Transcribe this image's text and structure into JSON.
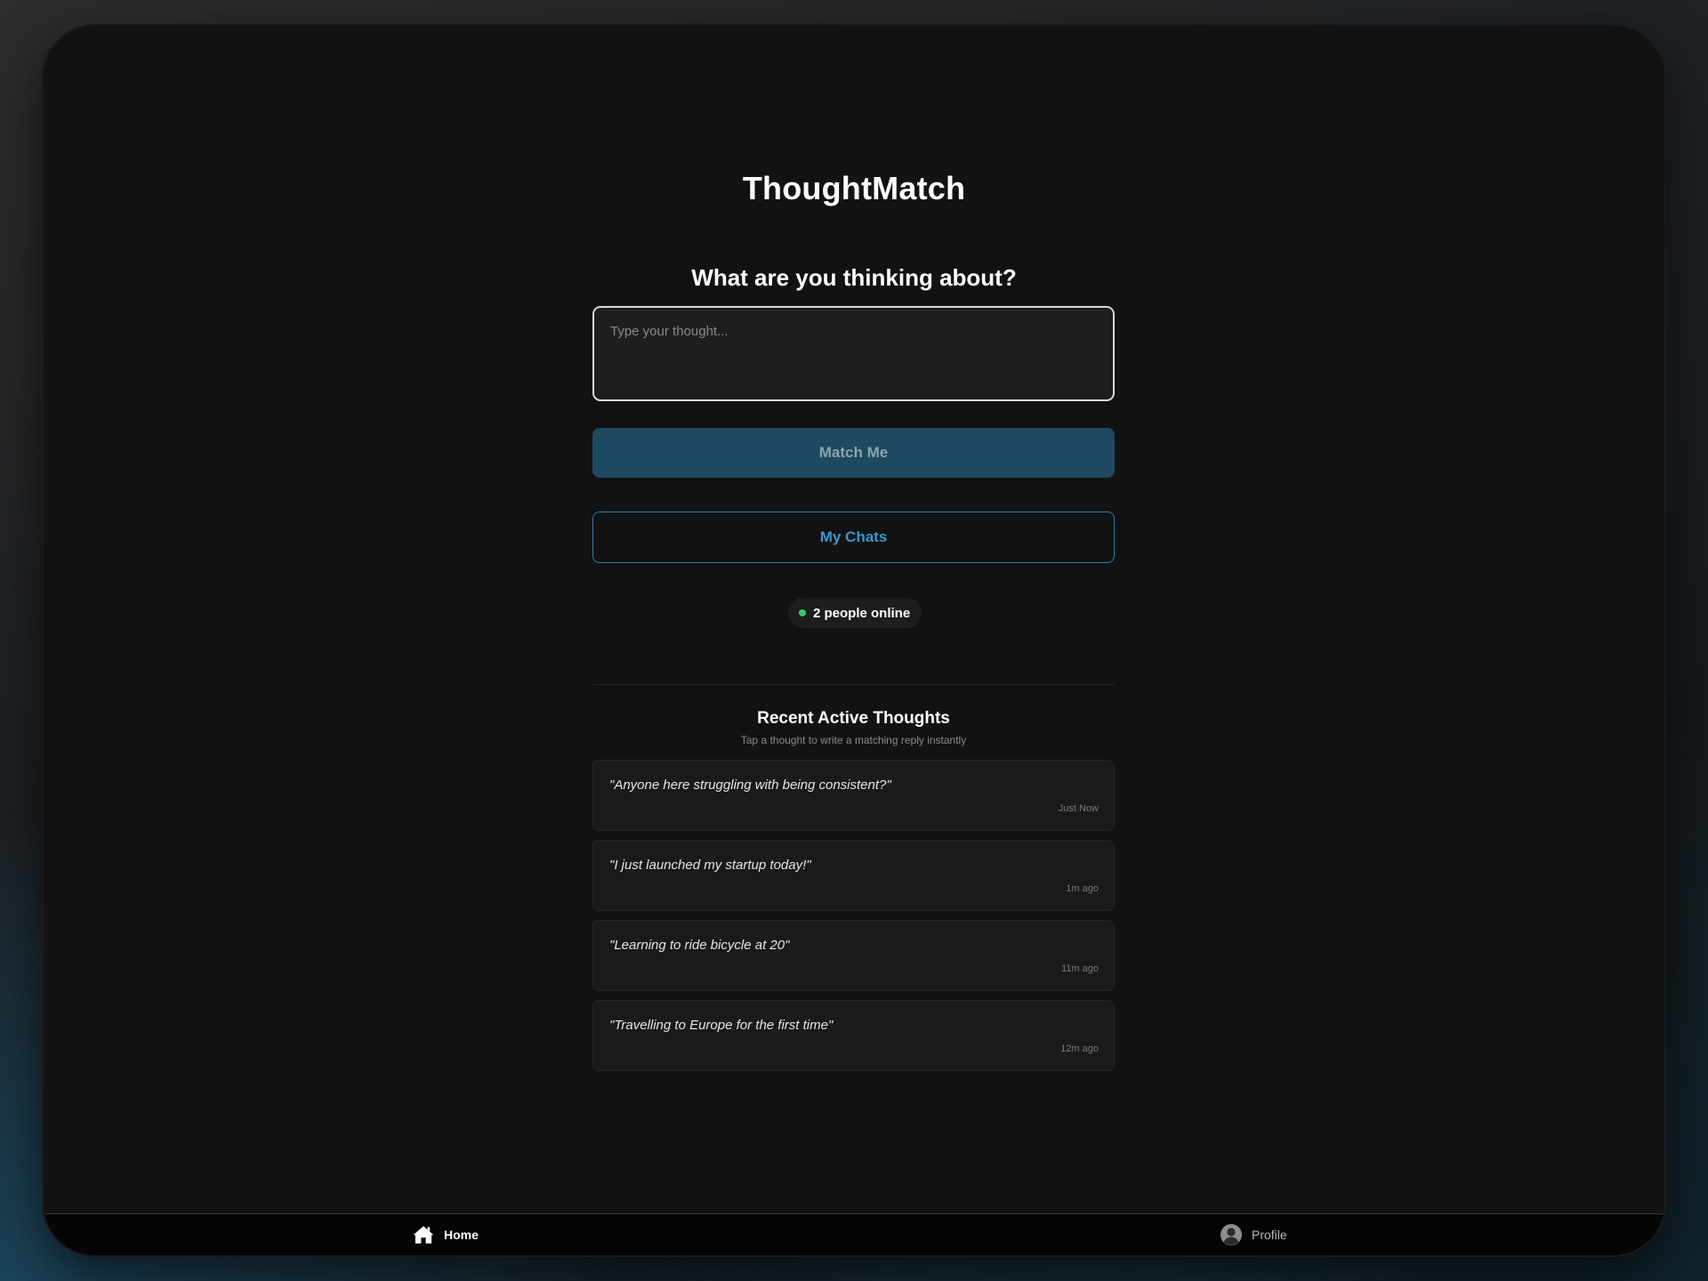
{
  "app": {
    "title": "ThoughtMatch"
  },
  "compose": {
    "prompt": "What are you thinking about?",
    "placeholder": "Type your thought...",
    "value": "",
    "match_label": "Match Me",
    "chats_label": "My Chats"
  },
  "status": {
    "online_text": "2 people online",
    "dot_color": "#2fd06b"
  },
  "recent": {
    "title": "Recent Active Thoughts",
    "subtitle": "Tap a thought to write a matching reply instantly",
    "items": [
      {
        "text": "\"Anyone here struggling with being consistent?\"",
        "time": "Just Now"
      },
      {
        "text": "\"I just launched my startup today!\"",
        "time": "1m ago"
      },
      {
        "text": "\"Learning to ride bicycle at 20\"",
        "time": "11m ago"
      },
      {
        "text": "\"Travelling to Europe for the first time\"",
        "time": "12m ago"
      }
    ]
  },
  "nav": {
    "home_label": "Home",
    "home_icon": "home-icon",
    "profile_label": "Profile",
    "profile_icon": "user-circle-icon"
  },
  "colors": {
    "accent": "#2a7fb0",
    "primary_button": "#1d4a61",
    "background": "#121212"
  }
}
